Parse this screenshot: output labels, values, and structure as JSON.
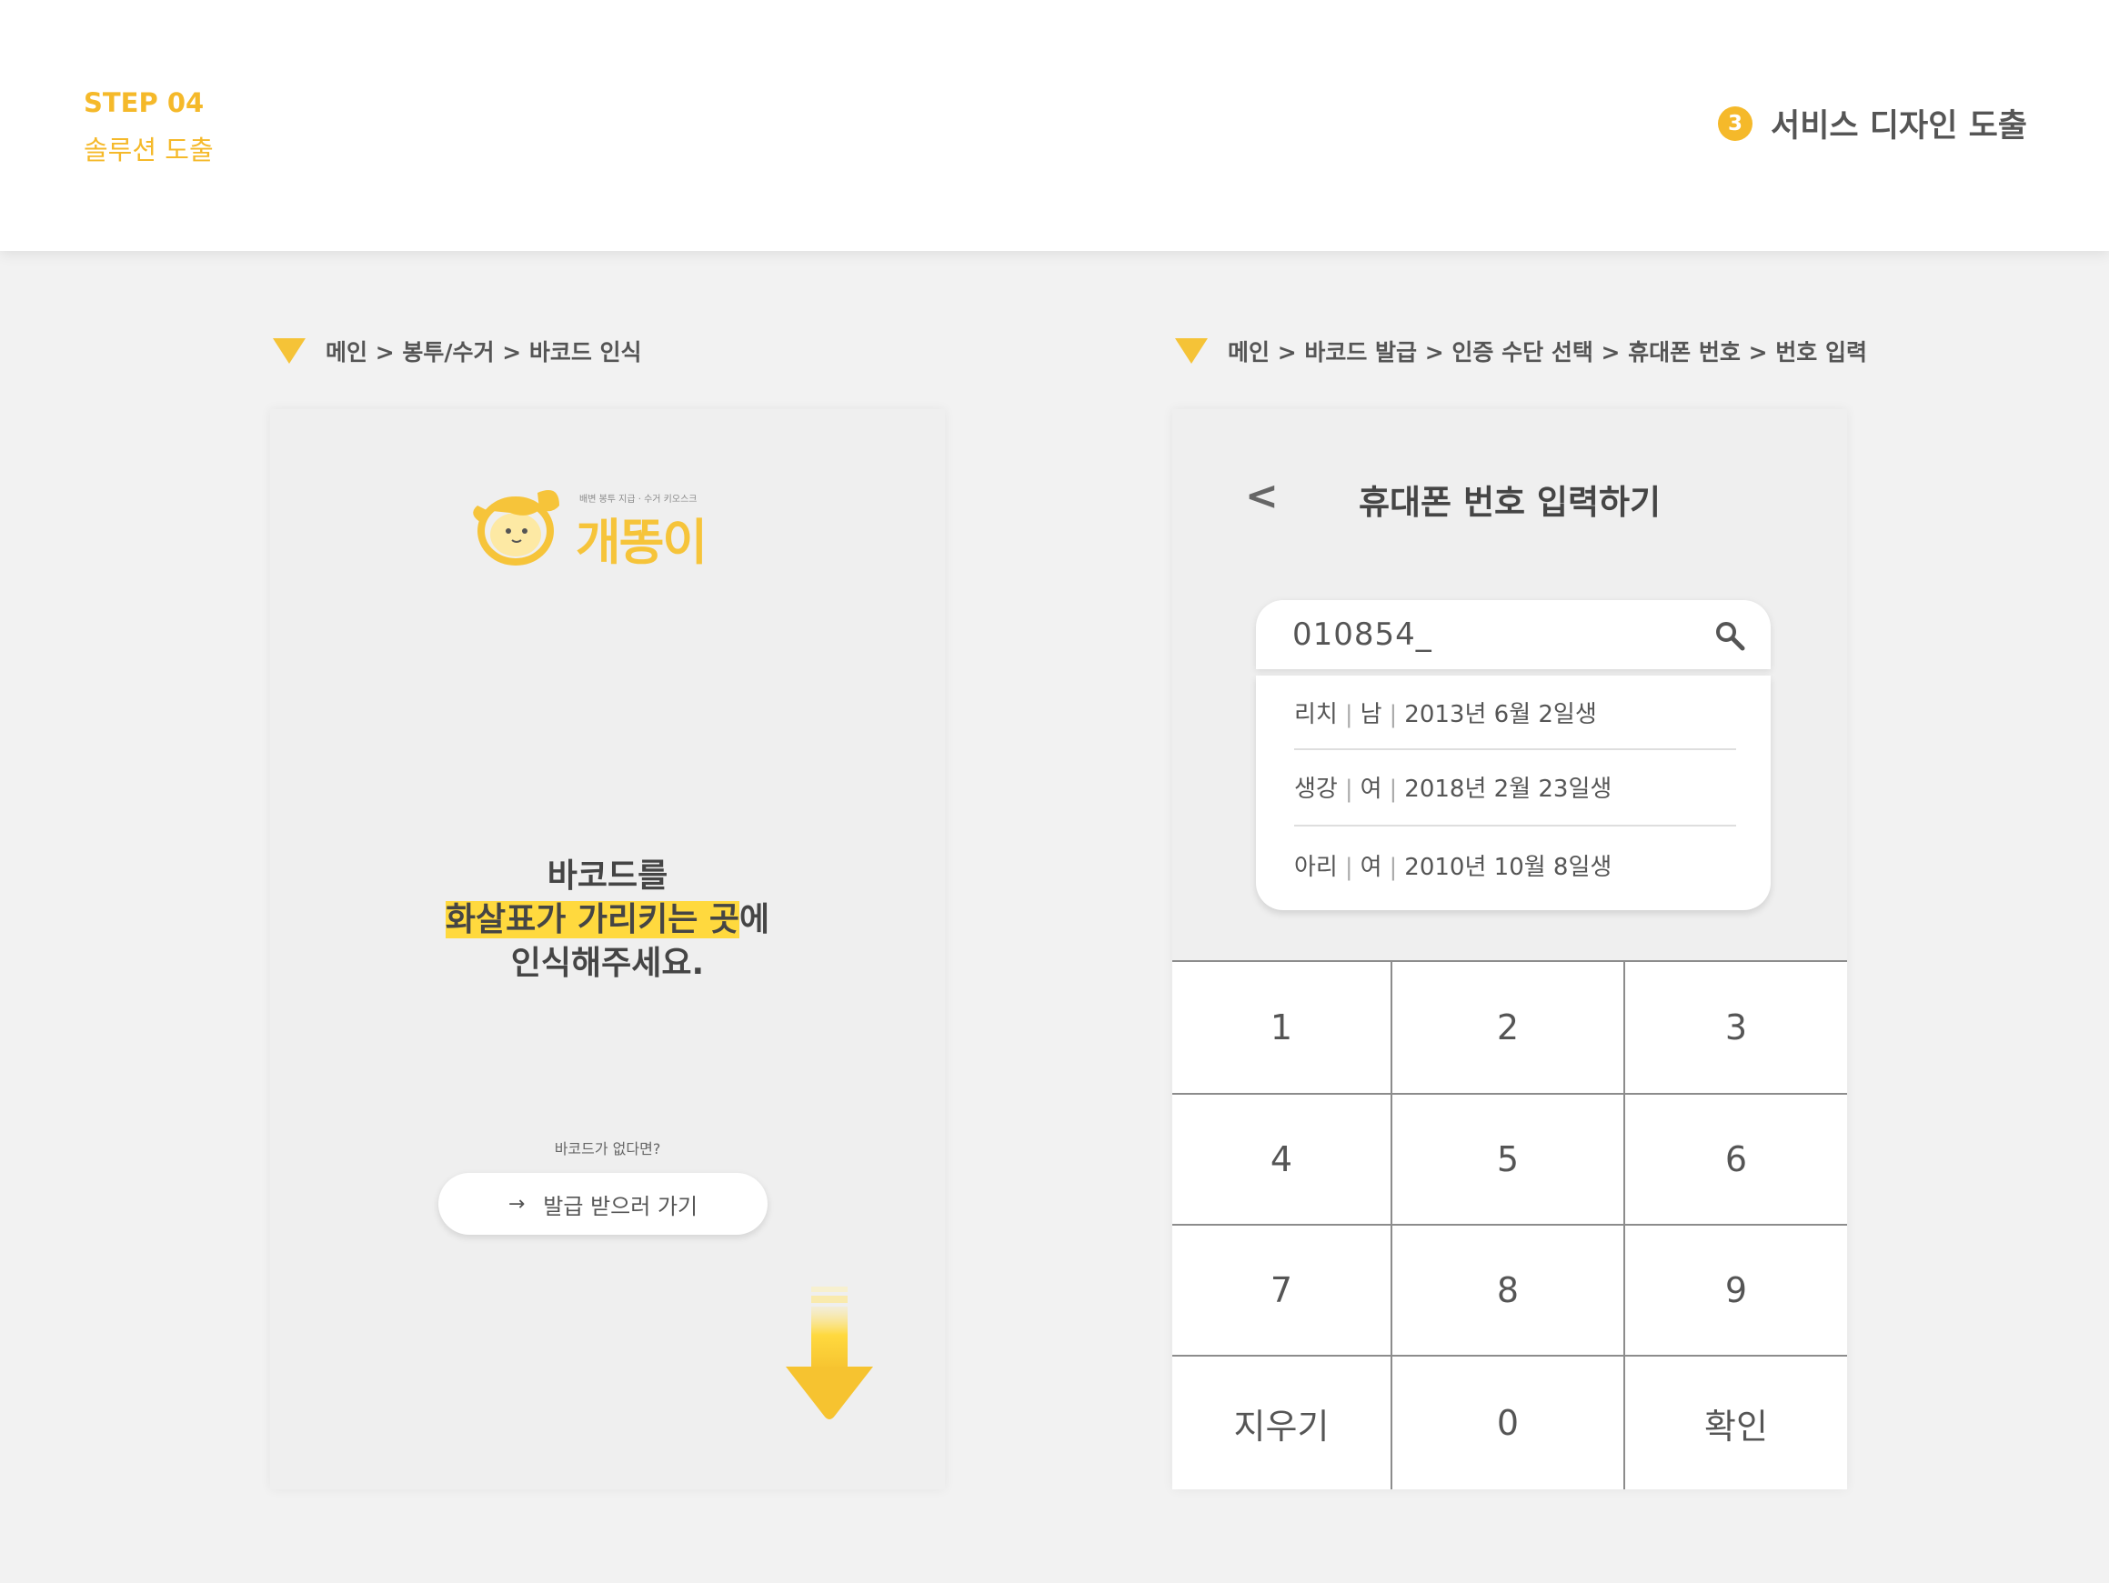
{
  "header": {
    "step": "STEP 04",
    "step_subtitle": "솔루션 도출",
    "section_number": "3",
    "section_title": "서비스 디자인 도출"
  },
  "left_screen": {
    "breadcrumb": "메인 > 봉투/수거 > 바코드 인식",
    "logo": {
      "tagline": "배변 봉투 지급 · 수거 키오스크",
      "name": "개똥이"
    },
    "message_line1": "바코드를",
    "message_line2_highlight": "화살표가 가리키는 곳",
    "message_line2_rest": "에",
    "message_line3": "인식해주세요.",
    "no_barcode_text": "바코드가 없다면?",
    "issue_button": {
      "arrow": "→",
      "label": "발급 받으러 가기"
    },
    "colors": {
      "accent": "#f5c337",
      "highlight": "#ffd93e"
    }
  },
  "right_screen": {
    "breadcrumb": "메인 > 바코드 발급 > 인증 수단 선택 > 휴대폰 번호 > 번호 입력",
    "back_label": "<",
    "title": "휴대폰 번호 입력하기",
    "search_value": "010854_",
    "results": [
      {
        "name": "리치",
        "gender": "남",
        "birth": "2013년 6월 2일생"
      },
      {
        "name": "생강",
        "gender": "여",
        "birth": "2018년 2월 23일생"
      },
      {
        "name": "아리",
        "gender": "여",
        "birth": "2010년 10월 8일생"
      }
    ],
    "keys": [
      "1",
      "2",
      "3",
      "4",
      "5",
      "6",
      "7",
      "8",
      "9",
      "지우기",
      "0",
      "확인"
    ]
  }
}
